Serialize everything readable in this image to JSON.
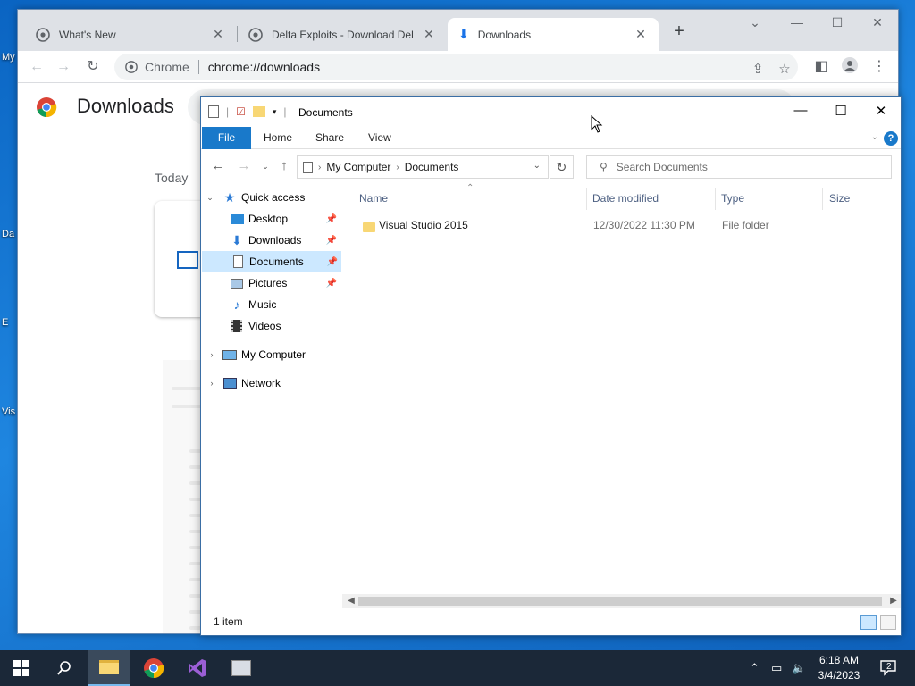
{
  "browser": {
    "tabs": [
      {
        "title": "What's New",
        "close": "✕"
      },
      {
        "title": "Delta Exploits - Download Delta",
        "close": "✕"
      },
      {
        "title": "Downloads",
        "close": "✕"
      }
    ],
    "new_tab": "+",
    "omnibox_chip": "Chrome",
    "url": "chrome://downloads",
    "page_title": "Downloads",
    "section_today": "Today"
  },
  "explorer": {
    "title": "Documents",
    "ribbon_tabs": [
      "File",
      "Home",
      "Share",
      "View"
    ],
    "address": {
      "root": "My Computer",
      "current": "Documents"
    },
    "search_placeholder": "Search Documents",
    "nav": {
      "quick_access": "Quick access",
      "items": [
        "Desktop",
        "Downloads",
        "Documents",
        "Pictures",
        "Music",
        "Videos"
      ],
      "my_computer": "My Computer",
      "network": "Network"
    },
    "columns": [
      "Name",
      "Date modified",
      "Type",
      "Size"
    ],
    "rows": [
      {
        "name": "Visual Studio 2015",
        "date": "12/30/2022 11:30 PM",
        "type": "File folder",
        "size": ""
      }
    ],
    "status": "1 item"
  },
  "desktop": {
    "labels": [
      "My",
      "Da",
      "E",
      "Vis"
    ]
  },
  "taskbar": {
    "time": "6:18 AM",
    "date": "3/4/2023",
    "notifications": "2"
  }
}
